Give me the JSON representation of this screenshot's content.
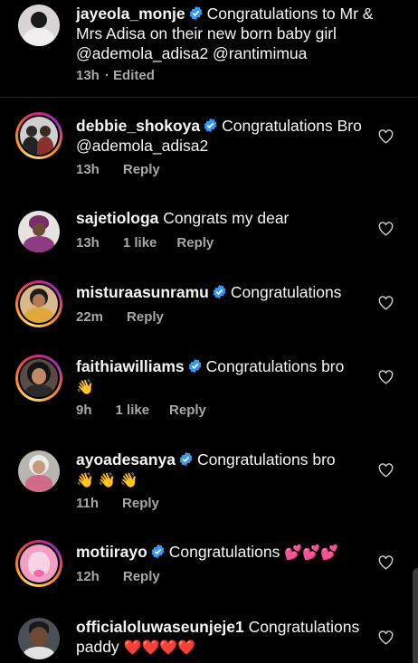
{
  "caption": {
    "username": "jayeola_monje",
    "verified": true,
    "text": "Congratulations to Mr & Mrs Adisa on their new born baby girl",
    "mentions": "@ademola_adisa2  @rantimimua",
    "time": "13h",
    "edited_label": "· Edited"
  },
  "comments": [
    {
      "username": "debbie_shokoya",
      "verified": true,
      "text": "Congratulations Bro @ademola_adisa2",
      "time": "13h",
      "likes": "",
      "reply": "Reply"
    },
    {
      "username": "sajetiologa",
      "verified": false,
      "text": "Congrats my dear",
      "time": "13h",
      "likes": "1 like",
      "reply": "Reply"
    },
    {
      "username": "misturaasunramu",
      "verified": true,
      "text": "Congratulations",
      "time": "22m",
      "likes": "",
      "reply": "Reply"
    },
    {
      "username": "faithiawilliams",
      "verified": true,
      "text": "Congratulations bro",
      "emoji": "👋",
      "time": "9h",
      "likes": "1 like",
      "reply": "Reply"
    },
    {
      "username": "ayoadesanya",
      "verified": true,
      "text": "Congratulations bro",
      "emoji": "👋 👋 👋",
      "time": "11h",
      "likes": "",
      "reply": "Reply"
    },
    {
      "username": "motiirayo",
      "verified": true,
      "text": "Congratulations",
      "emoji": "💕💕💕",
      "time": "12h",
      "likes": "",
      "reply": "Reply"
    },
    {
      "username": "officialoluwaseunjeje1",
      "verified": false,
      "text": "Congratulations paddy",
      "emoji": "❤️❤️❤️❤️",
      "time": "",
      "likes": "",
      "reply": ""
    }
  ],
  "icons": {
    "verified_badge": "verified-icon",
    "like": "heart-icon"
  },
  "colors": {
    "background": "#000000",
    "text": "#f5f5f5",
    "meta": "#a8a8a8",
    "verified": "#3897f0"
  }
}
